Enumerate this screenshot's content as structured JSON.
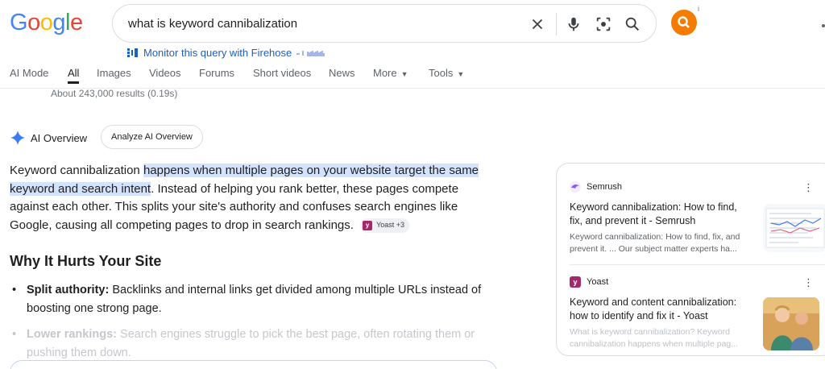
{
  "logo": {
    "letters": [
      "G",
      "o",
      "o",
      "g",
      "l",
      "e"
    ],
    "colors": [
      "#4285f4",
      "#ea4335",
      "#fbbc05",
      "#4285f4",
      "#34a853",
      "#ea4335"
    ]
  },
  "search": {
    "query": "what is keyword cannibalization",
    "icons": [
      "close-icon",
      "mic-icon",
      "lens-icon",
      "search-icon"
    ]
  },
  "avatar": {
    "color": "#f57c00",
    "info": "i"
  },
  "firehose": {
    "label": "Monitor this query with Firehose"
  },
  "tabs": [
    {
      "label": "AI Mode"
    },
    {
      "label": "All"
    },
    {
      "label": "Images"
    },
    {
      "label": "Videos"
    },
    {
      "label": "Forums"
    },
    {
      "label": "Short videos"
    },
    {
      "label": "News"
    },
    {
      "label": "More"
    },
    {
      "label": "Tools"
    }
  ],
  "results_count": "About 243,000 results (0.19s)",
  "ai_overview": {
    "title": "AI Overview",
    "analyze_label": "Analyze AI Overview",
    "para_start": "Keyword cannibalization ",
    "para_highlight": "happens when multiple pages on your website target the same keyword and search intent",
    "para_rest": ". Instead of helping you rank better, these pages compete against each other. This splits your site's authority and confuses search engines like Google, causing all competing pages to drop in search rankings.",
    "chip_label": "Yoast +3",
    "section_heading": "Why It Hurts Your Site",
    "bullets": [
      {
        "term": "Split authority:",
        "text": " Backlinks and internal links get divided among multiple URLs instead of boosting one strong page."
      },
      {
        "term": "Lower rankings:",
        "text": " Search engines struggle to pick the best page, often rotating them or pushing them down."
      }
    ]
  },
  "sources": [
    {
      "site": "Semrush",
      "title": "Keyword cannibalization: How to find, fix, and prevent it - Semrush",
      "snippet": "Keyword cannibalization: How to find, fix, and prevent it. ... Our subject matter experts ha...",
      "logo_color": "#8a5cf5"
    },
    {
      "site": "Yoast",
      "title": "Keyword and content cannibalization: how to identify and fix it - Yoast",
      "snippet": "What is keyword cannibalization? Keyword cannibalization happens when multiple pag...",
      "logo_color": "#a4286a"
    }
  ],
  "kebab": "⋮"
}
